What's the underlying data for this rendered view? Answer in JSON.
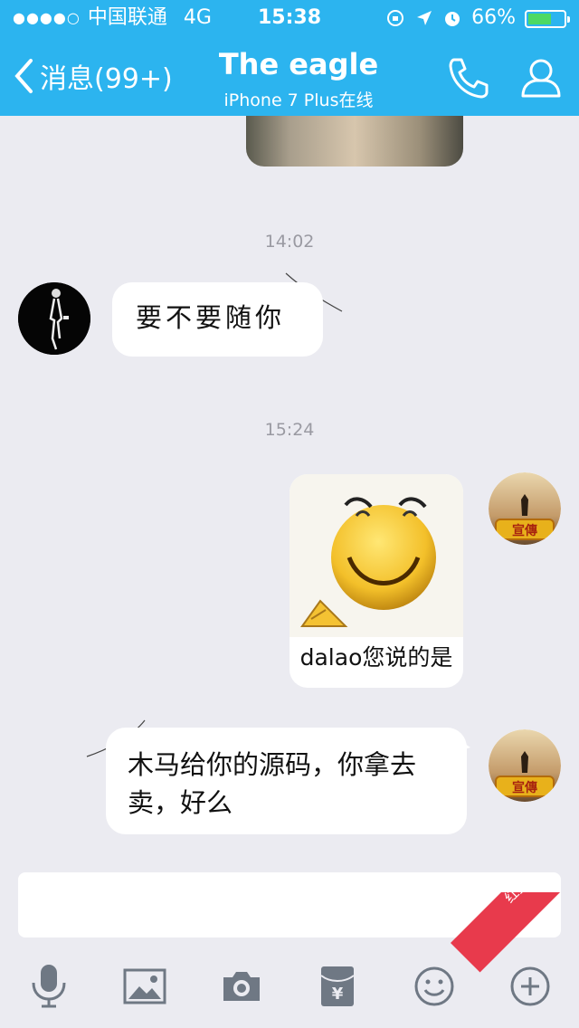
{
  "status_bar": {
    "signal": "●●●●○",
    "carrier": "中国联通",
    "network": "4G",
    "time": "15:38",
    "battery_percent": "66%",
    "battery_level": 0.66,
    "battery_color": "#4cd964"
  },
  "nav": {
    "back_label": "消息(99+)",
    "title": "The eagle",
    "subtitle": "iPhone 7 Plus在线",
    "accent_color": "#2cb4ef"
  },
  "messages": {
    "time_1": "14:02",
    "msg_1": "要不要随你",
    "time_2": "15:24",
    "sticker_caption": "dalao您说的是",
    "msg_3": "木马给你的源码，你拿去卖，好么",
    "avatar_badge": "宣傳"
  },
  "toolbar": {
    "icons": [
      "microphone-icon",
      "image-icon",
      "camera-icon",
      "red-packet-icon",
      "emoji-icon",
      "plus-icon"
    ]
  },
  "watermark": {
    "text": "红盟安全网"
  }
}
